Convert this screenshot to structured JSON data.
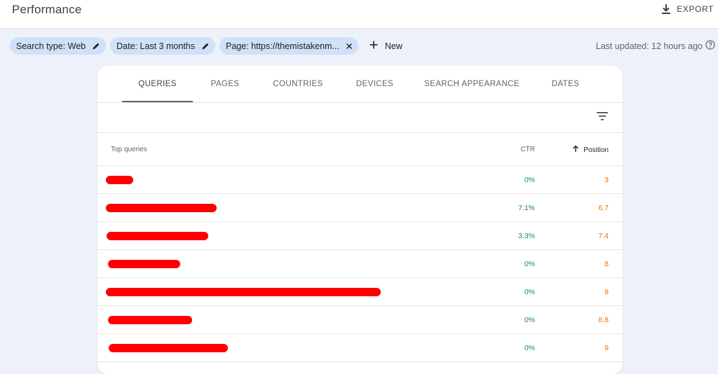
{
  "header": {
    "title": "Performance",
    "export_label": "EXPORT",
    "export_icon": "download-icon"
  },
  "filters": {
    "chips": [
      {
        "label": "Search type: Web",
        "icon": "edit-icon"
      },
      {
        "label": "Date: Last 3 months",
        "icon": "edit-icon"
      },
      {
        "label": "Page: https://themistakenm...",
        "icon": "close-icon"
      }
    ],
    "new_label": "New",
    "last_updated": "Last updated: 12 hours ago"
  },
  "tabs": [
    {
      "label": "QUERIES",
      "active": true
    },
    {
      "label": "PAGES",
      "active": false
    },
    {
      "label": "COUNTRIES",
      "active": false
    },
    {
      "label": "DEVICES",
      "active": false
    },
    {
      "label": "SEARCH APPEARANCE",
      "active": false
    },
    {
      "label": "DATES",
      "active": false
    }
  ],
  "table": {
    "columns": {
      "query": "Top queries",
      "ctr": "CTR",
      "position": "Position"
    },
    "sort": {
      "column": "position",
      "direction": "ascending"
    },
    "rows": [
      {
        "query": "[redacted]",
        "ctr": "0%",
        "position": "3"
      },
      {
        "query": "[redacted]",
        "ctr": "7.1%",
        "position": "6.7"
      },
      {
        "query": "[redacted]",
        "ctr": "3.3%",
        "position": "7.4"
      },
      {
        "query": "[redacted]",
        "ctr": "0%",
        "position": "8"
      },
      {
        "query": "[redacted]",
        "ctr": "0%",
        "position": "8"
      },
      {
        "query": "[redacted]",
        "ctr": "0%",
        "position": "8.8"
      },
      {
        "query": "[redacted]",
        "ctr": "0%",
        "position": "9"
      }
    ]
  },
  "colors": {
    "ctr": "#1e8e3e",
    "position": "#e8710a",
    "redaction": "#ff0000",
    "chip": "#cfe0f8"
  }
}
